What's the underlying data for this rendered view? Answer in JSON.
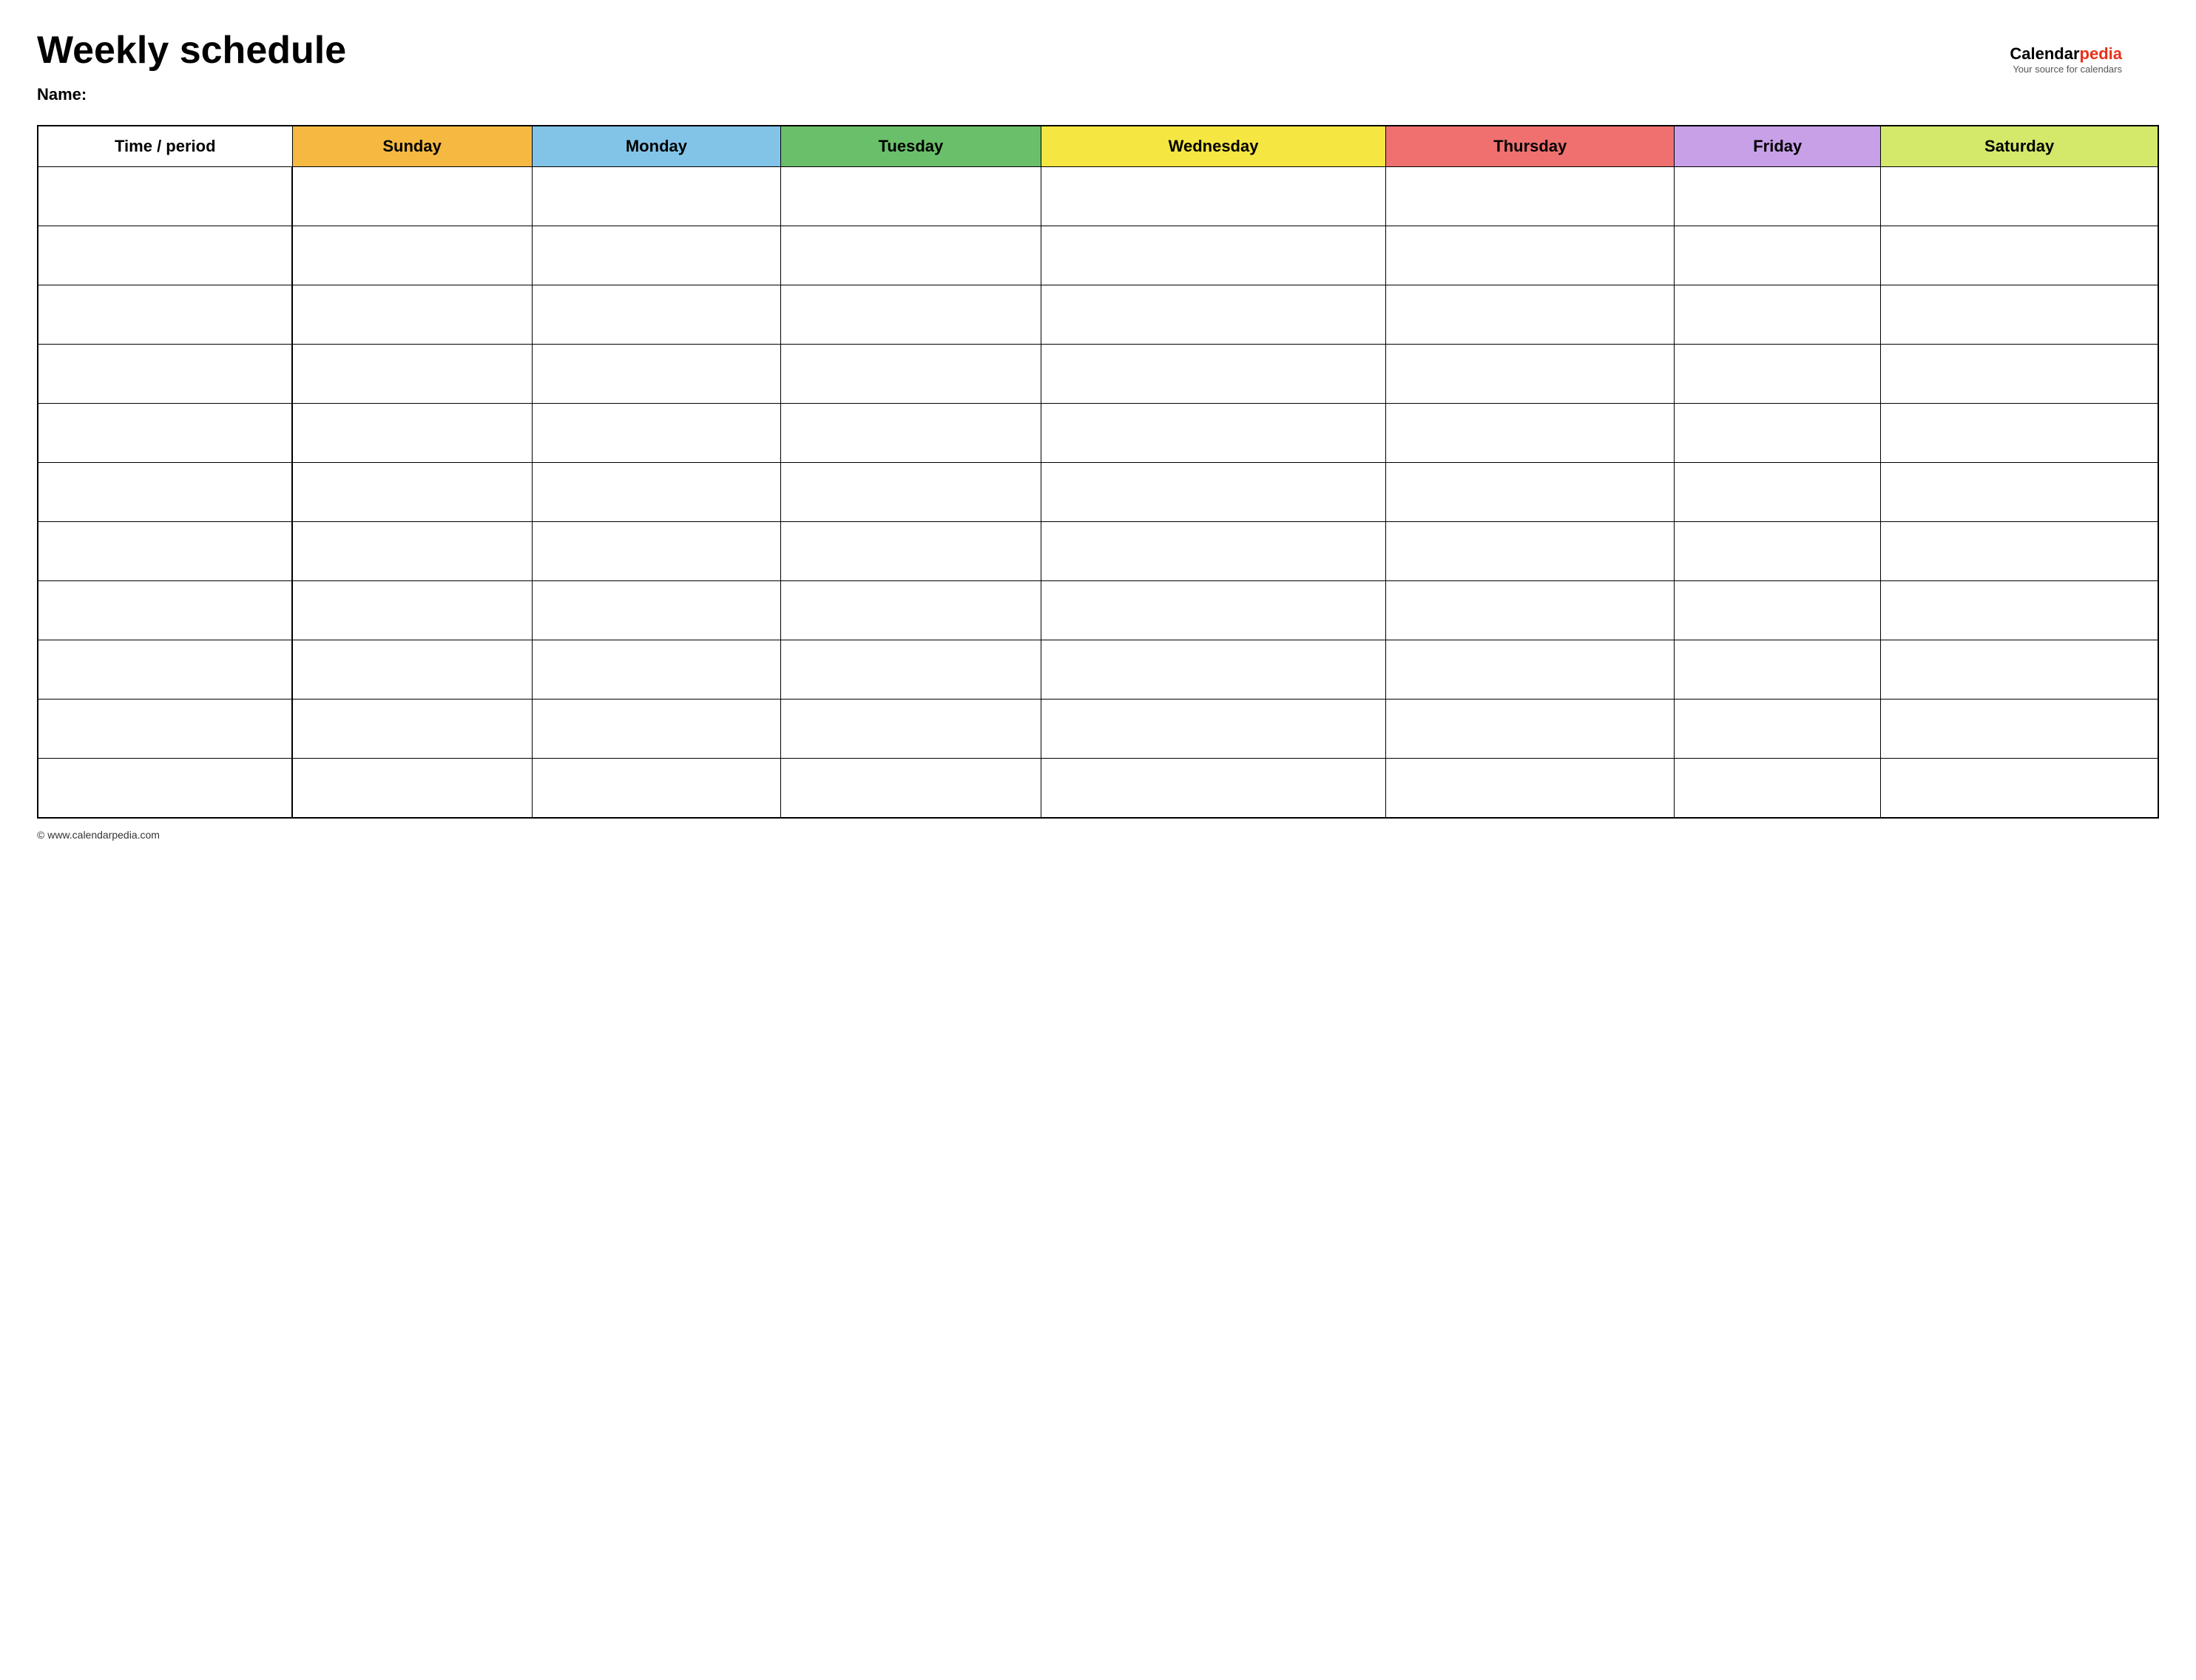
{
  "page": {
    "title": "Weekly schedule",
    "name_label": "Name:",
    "footer_url": "© www.calendarpedia.com"
  },
  "logo": {
    "brand_calendar": "Calendar",
    "brand_pedia": "pedia",
    "tagline": "Your source for calendars"
  },
  "table": {
    "header": {
      "time_period": "Time / period",
      "sunday": "Sunday",
      "monday": "Monday",
      "tuesday": "Tuesday",
      "wednesday": "Wednesday",
      "thursday": "Thursday",
      "friday": "Friday",
      "saturday": "Saturday"
    },
    "row_count": 11
  }
}
